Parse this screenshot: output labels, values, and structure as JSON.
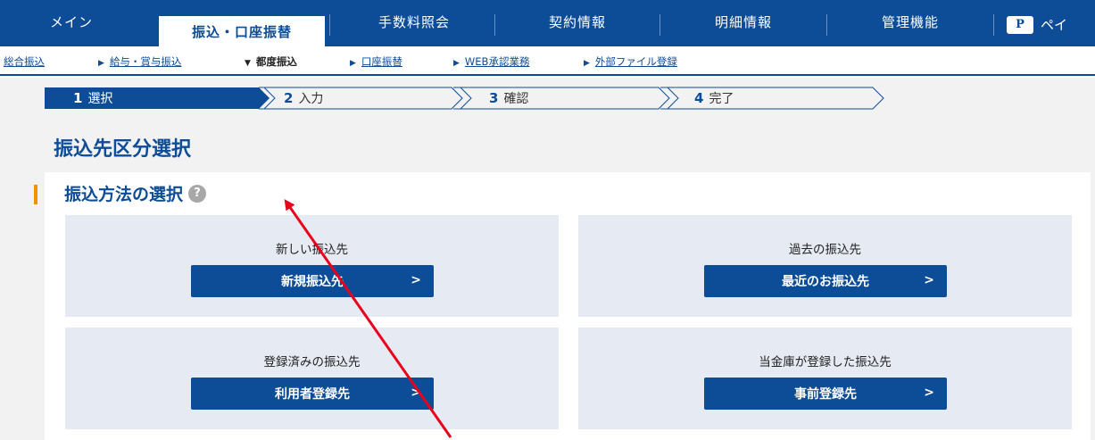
{
  "topnav": {
    "tabs": [
      {
        "label": "メイン"
      },
      {
        "label": "振込・口座振替"
      },
      {
        "label": "手数料照会"
      },
      {
        "label": "契約情報"
      },
      {
        "label": "明細情報"
      },
      {
        "label": "管理機能"
      }
    ],
    "payeasy_label": "ペイ",
    "payeasy_logo": "P"
  },
  "subnav": {
    "items": [
      {
        "label": "総合振込"
      },
      {
        "label": "給与・賞与振込"
      },
      {
        "label": "都度振込"
      },
      {
        "label": "口座振替"
      },
      {
        "label": "WEB承認業務"
      },
      {
        "label": "外部ファイル登録"
      }
    ]
  },
  "steps": [
    {
      "num": "1",
      "label": "選択"
    },
    {
      "num": "2",
      "label": "入力"
    },
    {
      "num": "3",
      "label": "確認"
    },
    {
      "num": "4",
      "label": "完了"
    }
  ],
  "page_title": "振込先区分選択",
  "section": {
    "title": "振込方法の選択",
    "help_icon": "?"
  },
  "cards": [
    {
      "title": "新しい振込先",
      "button": "新規振込先"
    },
    {
      "title": "過去の振込先",
      "button": "最近のお振込先"
    },
    {
      "title": "登録済みの振込先",
      "button": "利用者登録先"
    },
    {
      "title": "当金庫が登録した振込先",
      "button": "事前登録先"
    }
  ],
  "colors": {
    "primary": "#0d4c97",
    "accent": "#f29400",
    "annotation": "#e8001c"
  }
}
